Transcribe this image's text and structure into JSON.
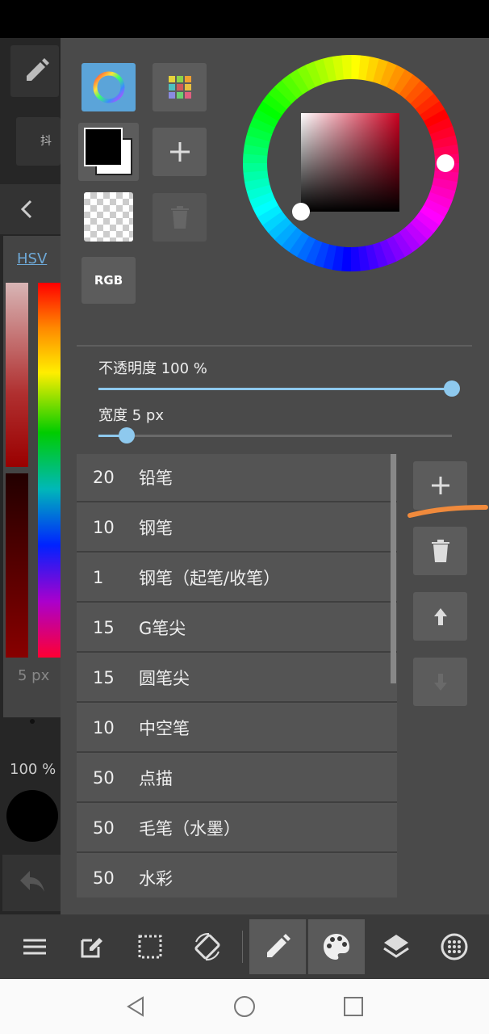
{
  "left_strip": {
    "tab_label": "抖音",
    "color_mode": "HSV",
    "brush_size": "5 px",
    "opacity": "100 %"
  },
  "color_panel": {
    "rgb_button": "RGB",
    "colors": {
      "foreground": "#000000",
      "background": "#ffffff",
      "accent": "#5ba4d9",
      "slider": "#8ec9ee"
    }
  },
  "sliders": {
    "opacity_label": "不透明度 100 %",
    "opacity_value": 100,
    "width_label": "宽度 5 px",
    "width_value": 5
  },
  "brushes": [
    {
      "size": "20",
      "name": "铅笔"
    },
    {
      "size": "10",
      "name": "钢笔"
    },
    {
      "size": "1",
      "name": "钢笔（起笔/收笔）"
    },
    {
      "size": "15",
      "name": "G笔尖"
    },
    {
      "size": "15",
      "name": "圆笔尖"
    },
    {
      "size": "10",
      "name": "中空笔"
    },
    {
      "size": "50",
      "name": "点描"
    },
    {
      "size": "50",
      "name": "毛笔（水墨）"
    },
    {
      "size": "50",
      "name": "水彩"
    }
  ],
  "toolbar": {
    "items": [
      "menu-icon",
      "edit-icon",
      "selection-icon",
      "rotate-icon",
      "pencil-icon",
      "palette-icon",
      "layers-icon",
      "material-icon"
    ],
    "active": [
      "pencil-icon",
      "palette-icon"
    ]
  }
}
